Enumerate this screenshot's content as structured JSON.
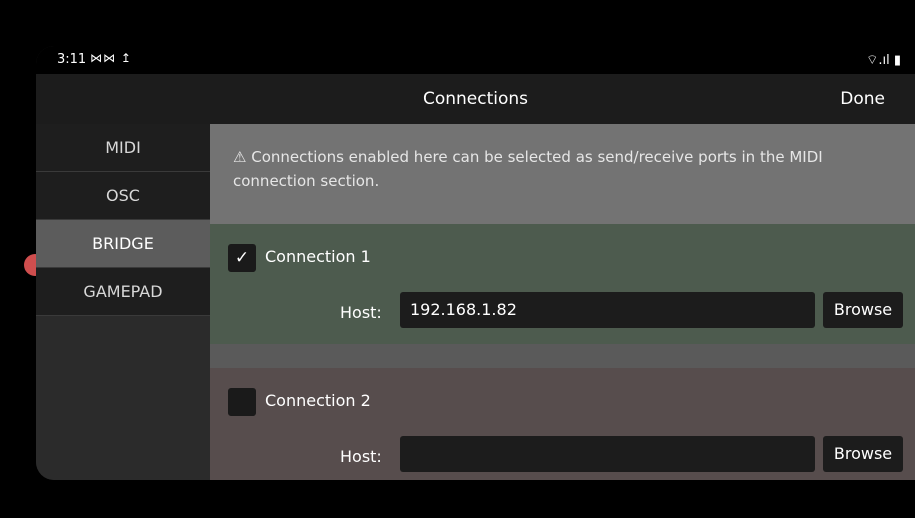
{
  "status": {
    "time": "3:11",
    "notifications": "⋈⋈ ↥",
    "system": "⌔.ıl ▮"
  },
  "header": {
    "title": "Connections",
    "done_label": "Done"
  },
  "sidebar": {
    "items": [
      {
        "label": "MIDI"
      },
      {
        "label": "OSC"
      },
      {
        "label": "BRIDGE"
      },
      {
        "label": "GAMEPAD"
      }
    ],
    "active": "BRIDGE"
  },
  "notice": {
    "text": "⚠ Connections enabled here can be selected as send/receive ports in the MIDI connection section."
  },
  "connections": [
    {
      "label": "Connection 1",
      "checked": true,
      "check_mark": "✓",
      "host_label": "Host:",
      "host_value": "192.168.1.82",
      "browse_label": "Browse"
    },
    {
      "label": "Connection 2",
      "checked": false,
      "check_mark": "",
      "host_label": "Host:",
      "host_value": "",
      "browse_label": "Browse"
    }
  ]
}
